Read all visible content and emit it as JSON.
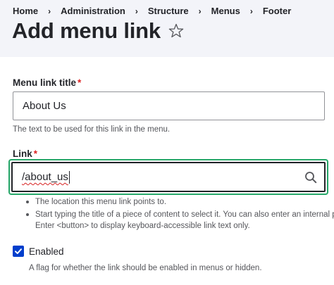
{
  "breadcrumb": {
    "items": [
      "Home",
      "Administration",
      "Structure",
      "Menus",
      "Footer"
    ],
    "separator": "›"
  },
  "page": {
    "title": "Add menu link"
  },
  "form": {
    "title_field": {
      "label": "Menu link title",
      "required_mark": "*",
      "value": "About Us",
      "description": "The text to be used for this link in the menu."
    },
    "link_field": {
      "label": "Link",
      "required_mark": "*",
      "value": "/about_us",
      "help_items": [
        "The location this menu link points to.",
        "Start typing the title of a piece of content to select it. You can also enter an internal path",
        "Enter <button> to display keyboard-accessible link text only."
      ]
    },
    "enabled": {
      "label": "Enabled",
      "checked": true,
      "description": "A flag for whether the link should be enabled in menus or hidden."
    }
  },
  "colors": {
    "header_bg": "#f3f4f9",
    "text": "#232429",
    "required": "#dc2323",
    "focus_ring": "#26a769",
    "checkbox": "#003ecc",
    "spellcheck_underline": "#d72222"
  },
  "icons": {
    "title_action": "star-outline-icon",
    "link_field_action": "search-icon",
    "checkbox_state": "checkmark-icon"
  }
}
